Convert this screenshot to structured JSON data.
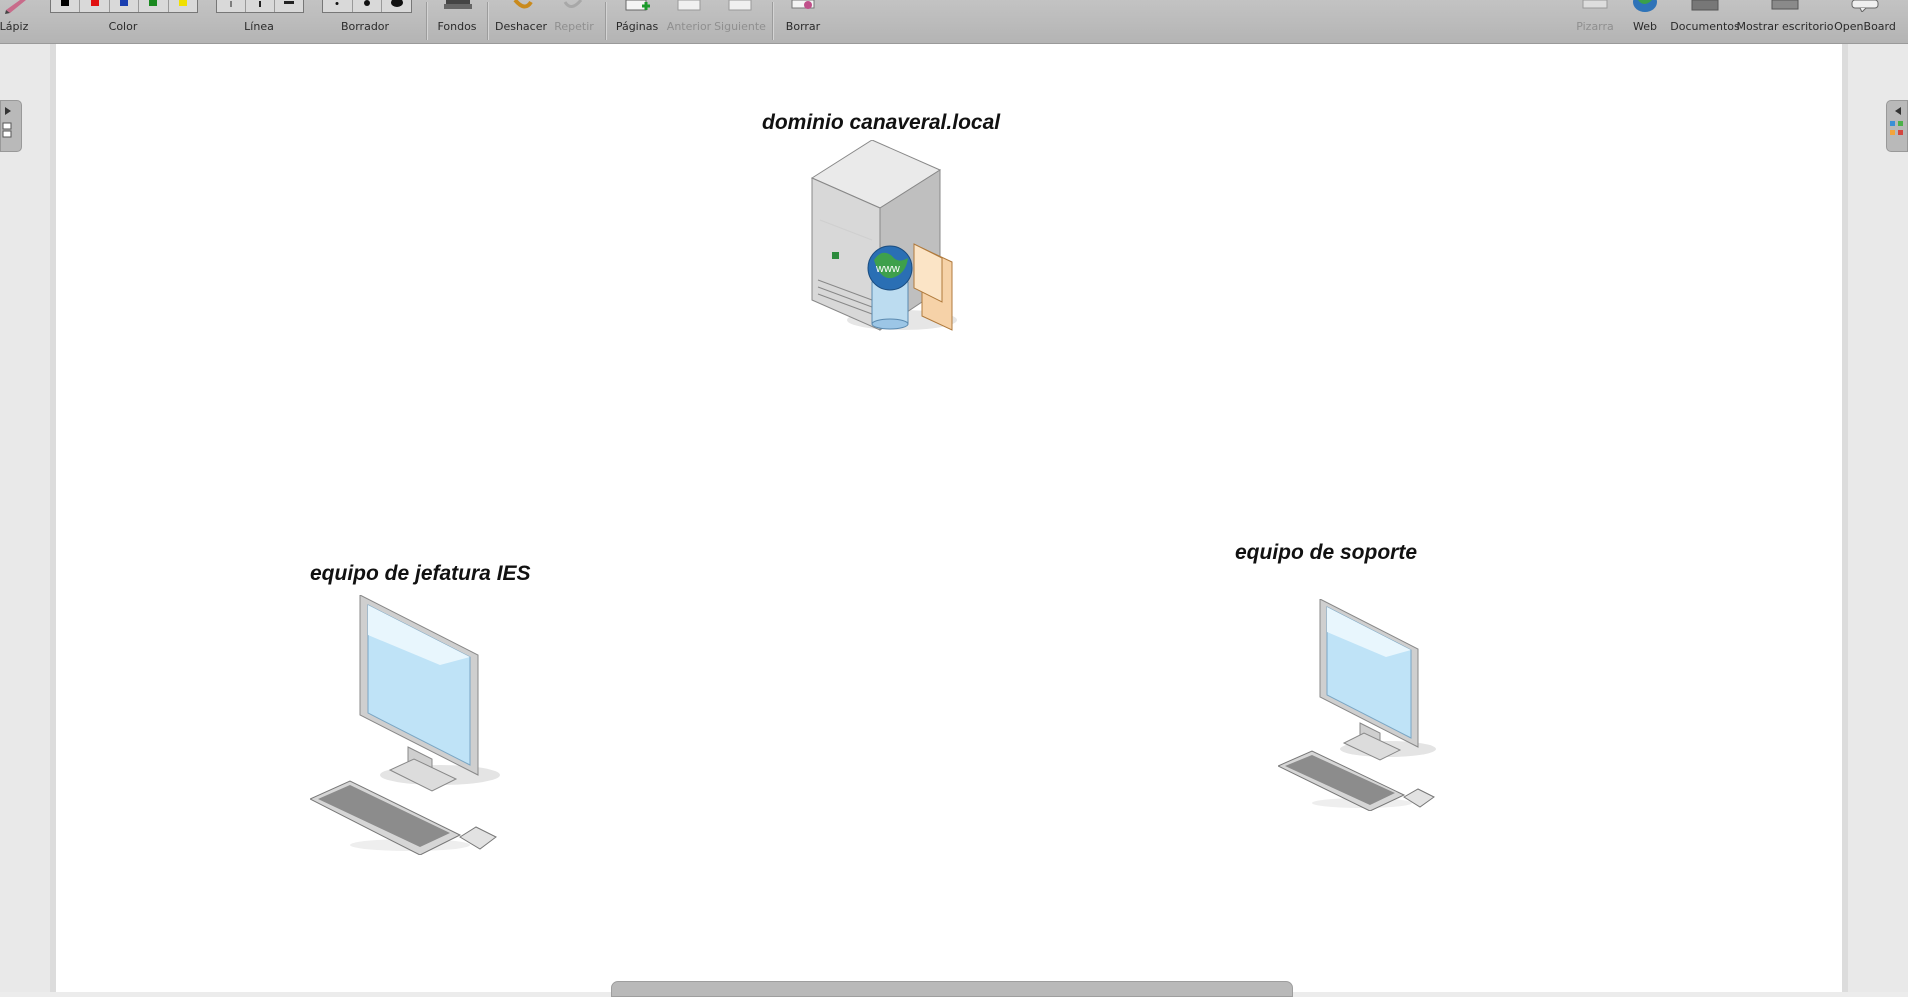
{
  "toolbar": {
    "pen_label": "Lápiz",
    "color_label": "Color",
    "line_label": "Línea",
    "eraser_label": "Borrador",
    "backgrounds_label": "Fondos",
    "undo_label": "Deshacer",
    "redo_label": "Repetir",
    "pages_label": "Páginas",
    "previous_label": "Anterior",
    "next_label": "Siguiente",
    "clear_label": "Borrar",
    "board_label": "Pizarra",
    "web_label": "Web",
    "documents_label": "Documentos",
    "show_desktop_label": "Mostrar escritorio",
    "openboard_label": "OpenBoard",
    "colors": [
      "#000000",
      "#e01010",
      "#1a3fb0",
      "#1a8a20",
      "#f0e000"
    ]
  },
  "board": {
    "server_caption": "dominio canaveral.local",
    "workstation_left_caption": "equipo de jefatura IES",
    "workstation_right_caption": "equipo de soporte"
  }
}
